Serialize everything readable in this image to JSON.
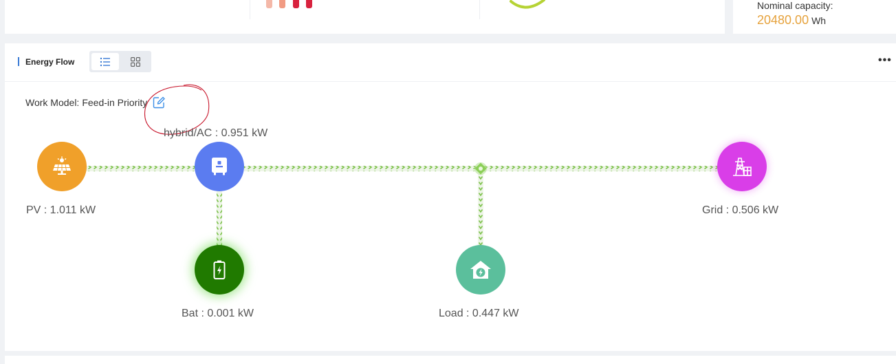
{
  "summary": {
    "nominal_label": "Nominal capacity:",
    "nominal_value": "20480.00",
    "nominal_unit": "Wh",
    "bar_colors": [
      "#f4b8a8",
      "#f19b83",
      "#d8223e",
      "#d8223e"
    ]
  },
  "panel": {
    "title": "Energy Flow",
    "view_options": [
      "list-view",
      "grid-view"
    ],
    "active_view": "list-view",
    "more_label": "•••"
  },
  "work_model": {
    "label": "Work Model:",
    "value": "Feed-in Priority"
  },
  "nodes": {
    "pv": {
      "label": "PV : 1.011 kW",
      "icon": "solar-panel-icon",
      "color": "#f0a02a"
    },
    "inverter": {
      "label": "hybrid/AC : 0.951 kW",
      "icon": "inverter-icon",
      "color": "#5b7cf0"
    },
    "battery": {
      "label": "Bat : 0.001 kW",
      "icon": "battery-icon",
      "color": "#207a00"
    },
    "load": {
      "label": "Load : 0.447 kW",
      "icon": "home-load-icon",
      "color": "#5bbf9c"
    },
    "grid": {
      "label": "Grid : 0.506 kW",
      "icon": "power-tower-icon",
      "color": "#d93ee8"
    }
  },
  "flow_color": "#7cc14a"
}
